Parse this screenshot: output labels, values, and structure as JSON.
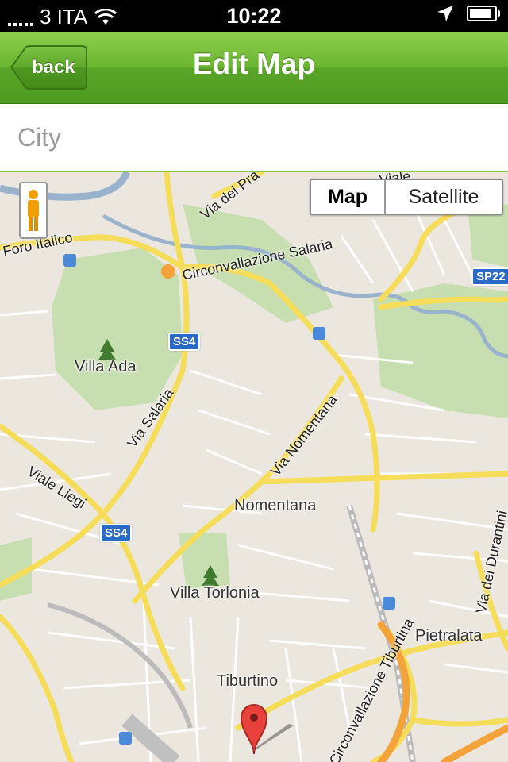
{
  "status_bar": {
    "carrier": "3 ITA",
    "time": "10:22",
    "battery_level": 0.85
  },
  "nav": {
    "title": "Edit Map",
    "back_label": "back"
  },
  "search": {
    "placeholder": "City",
    "value": ""
  },
  "map": {
    "map_type_options": [
      "Map",
      "Satellite"
    ],
    "selected_map_type": "Map",
    "places": {
      "villa_ada": "Villa Ada",
      "villa_torlonia": "Villa Torlonia",
      "nomentana": "Nomentana",
      "tiburtino": "Tiburtino",
      "pietralata": "Pietralata"
    },
    "roads": {
      "foro_italico": "Foro Italico",
      "circonvallazione_salaria": "Circonvallazione Salaria",
      "via_dei_prati": "Via dei Pra",
      "via_salaria": "Via Salaria",
      "via_nomentana": "Via Nomentana",
      "viale_liegi": "Viale Liegi",
      "via_dei_durantini": "Via dei Durantini",
      "tiburtina": "Circonvallazione Tiburtina",
      "viale": "Viale"
    },
    "shields": {
      "ss4_upper": "SS4",
      "ss4_lower": "SS4",
      "sp22": "SP22"
    },
    "colors": {
      "park": "#c7deb0",
      "water": "#99b3cc",
      "major_road": "#f6dd59",
      "minor_road": "#ffffff",
      "land": "#ebe7df"
    }
  }
}
